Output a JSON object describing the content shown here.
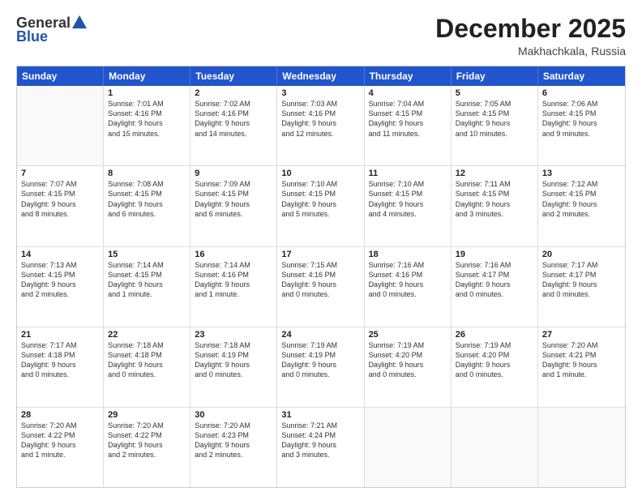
{
  "header": {
    "logo_general": "General",
    "logo_blue": "Blue",
    "month_title": "December 2025",
    "location": "Makhachkala, Russia"
  },
  "weekdays": [
    "Sunday",
    "Monday",
    "Tuesday",
    "Wednesday",
    "Thursday",
    "Friday",
    "Saturday"
  ],
  "rows": [
    [
      {
        "day": "",
        "lines": []
      },
      {
        "day": "1",
        "lines": [
          "Sunrise: 7:01 AM",
          "Sunset: 4:16 PM",
          "Daylight: 9 hours",
          "and 15 minutes."
        ]
      },
      {
        "day": "2",
        "lines": [
          "Sunrise: 7:02 AM",
          "Sunset: 4:16 PM",
          "Daylight: 9 hours",
          "and 14 minutes."
        ]
      },
      {
        "day": "3",
        "lines": [
          "Sunrise: 7:03 AM",
          "Sunset: 4:16 PM",
          "Daylight: 9 hours",
          "and 12 minutes."
        ]
      },
      {
        "day": "4",
        "lines": [
          "Sunrise: 7:04 AM",
          "Sunset: 4:15 PM",
          "Daylight: 9 hours",
          "and 11 minutes."
        ]
      },
      {
        "day": "5",
        "lines": [
          "Sunrise: 7:05 AM",
          "Sunset: 4:15 PM",
          "Daylight: 9 hours",
          "and 10 minutes."
        ]
      },
      {
        "day": "6",
        "lines": [
          "Sunrise: 7:06 AM",
          "Sunset: 4:15 PM",
          "Daylight: 9 hours",
          "and 9 minutes."
        ]
      }
    ],
    [
      {
        "day": "7",
        "lines": [
          "Sunrise: 7:07 AM",
          "Sunset: 4:15 PM",
          "Daylight: 9 hours",
          "and 8 minutes."
        ]
      },
      {
        "day": "8",
        "lines": [
          "Sunrise: 7:08 AM",
          "Sunset: 4:15 PM",
          "Daylight: 9 hours",
          "and 6 minutes."
        ]
      },
      {
        "day": "9",
        "lines": [
          "Sunrise: 7:09 AM",
          "Sunset: 4:15 PM",
          "Daylight: 9 hours",
          "and 6 minutes."
        ]
      },
      {
        "day": "10",
        "lines": [
          "Sunrise: 7:10 AM",
          "Sunset: 4:15 PM",
          "Daylight: 9 hours",
          "and 5 minutes."
        ]
      },
      {
        "day": "11",
        "lines": [
          "Sunrise: 7:10 AM",
          "Sunset: 4:15 PM",
          "Daylight: 9 hours",
          "and 4 minutes."
        ]
      },
      {
        "day": "12",
        "lines": [
          "Sunrise: 7:11 AM",
          "Sunset: 4:15 PM",
          "Daylight: 9 hours",
          "and 3 minutes."
        ]
      },
      {
        "day": "13",
        "lines": [
          "Sunrise: 7:12 AM",
          "Sunset: 4:15 PM",
          "Daylight: 9 hours",
          "and 2 minutes."
        ]
      }
    ],
    [
      {
        "day": "14",
        "lines": [
          "Sunrise: 7:13 AM",
          "Sunset: 4:15 PM",
          "Daylight: 9 hours",
          "and 2 minutes."
        ]
      },
      {
        "day": "15",
        "lines": [
          "Sunrise: 7:14 AM",
          "Sunset: 4:15 PM",
          "Daylight: 9 hours",
          "and 1 minute."
        ]
      },
      {
        "day": "16",
        "lines": [
          "Sunrise: 7:14 AM",
          "Sunset: 4:16 PM",
          "Daylight: 9 hours",
          "and 1 minute."
        ]
      },
      {
        "day": "17",
        "lines": [
          "Sunrise: 7:15 AM",
          "Sunset: 4:16 PM",
          "Daylight: 9 hours",
          "and 0 minutes."
        ]
      },
      {
        "day": "18",
        "lines": [
          "Sunrise: 7:16 AM",
          "Sunset: 4:16 PM",
          "Daylight: 9 hours",
          "and 0 minutes."
        ]
      },
      {
        "day": "19",
        "lines": [
          "Sunrise: 7:16 AM",
          "Sunset: 4:17 PM",
          "Daylight: 9 hours",
          "and 0 minutes."
        ]
      },
      {
        "day": "20",
        "lines": [
          "Sunrise: 7:17 AM",
          "Sunset: 4:17 PM",
          "Daylight: 9 hours",
          "and 0 minutes."
        ]
      }
    ],
    [
      {
        "day": "21",
        "lines": [
          "Sunrise: 7:17 AM",
          "Sunset: 4:18 PM",
          "Daylight: 9 hours",
          "and 0 minutes."
        ]
      },
      {
        "day": "22",
        "lines": [
          "Sunrise: 7:18 AM",
          "Sunset: 4:18 PM",
          "Daylight: 9 hours",
          "and 0 minutes."
        ]
      },
      {
        "day": "23",
        "lines": [
          "Sunrise: 7:18 AM",
          "Sunset: 4:19 PM",
          "Daylight: 9 hours",
          "and 0 minutes."
        ]
      },
      {
        "day": "24",
        "lines": [
          "Sunrise: 7:19 AM",
          "Sunset: 4:19 PM",
          "Daylight: 9 hours",
          "and 0 minutes."
        ]
      },
      {
        "day": "25",
        "lines": [
          "Sunrise: 7:19 AM",
          "Sunset: 4:20 PM",
          "Daylight: 9 hours",
          "and 0 minutes."
        ]
      },
      {
        "day": "26",
        "lines": [
          "Sunrise: 7:19 AM",
          "Sunset: 4:20 PM",
          "Daylight: 9 hours",
          "and 0 minutes."
        ]
      },
      {
        "day": "27",
        "lines": [
          "Sunrise: 7:20 AM",
          "Sunset: 4:21 PM",
          "Daylight: 9 hours",
          "and 1 minute."
        ]
      }
    ],
    [
      {
        "day": "28",
        "lines": [
          "Sunrise: 7:20 AM",
          "Sunset: 4:22 PM",
          "Daylight: 9 hours",
          "and 1 minute."
        ]
      },
      {
        "day": "29",
        "lines": [
          "Sunrise: 7:20 AM",
          "Sunset: 4:22 PM",
          "Daylight: 9 hours",
          "and 2 minutes."
        ]
      },
      {
        "day": "30",
        "lines": [
          "Sunrise: 7:20 AM",
          "Sunset: 4:23 PM",
          "Daylight: 9 hours",
          "and 2 minutes."
        ]
      },
      {
        "day": "31",
        "lines": [
          "Sunrise: 7:21 AM",
          "Sunset: 4:24 PM",
          "Daylight: 9 hours",
          "and 3 minutes."
        ]
      },
      {
        "day": "",
        "lines": []
      },
      {
        "day": "",
        "lines": []
      },
      {
        "day": "",
        "lines": []
      }
    ]
  ]
}
